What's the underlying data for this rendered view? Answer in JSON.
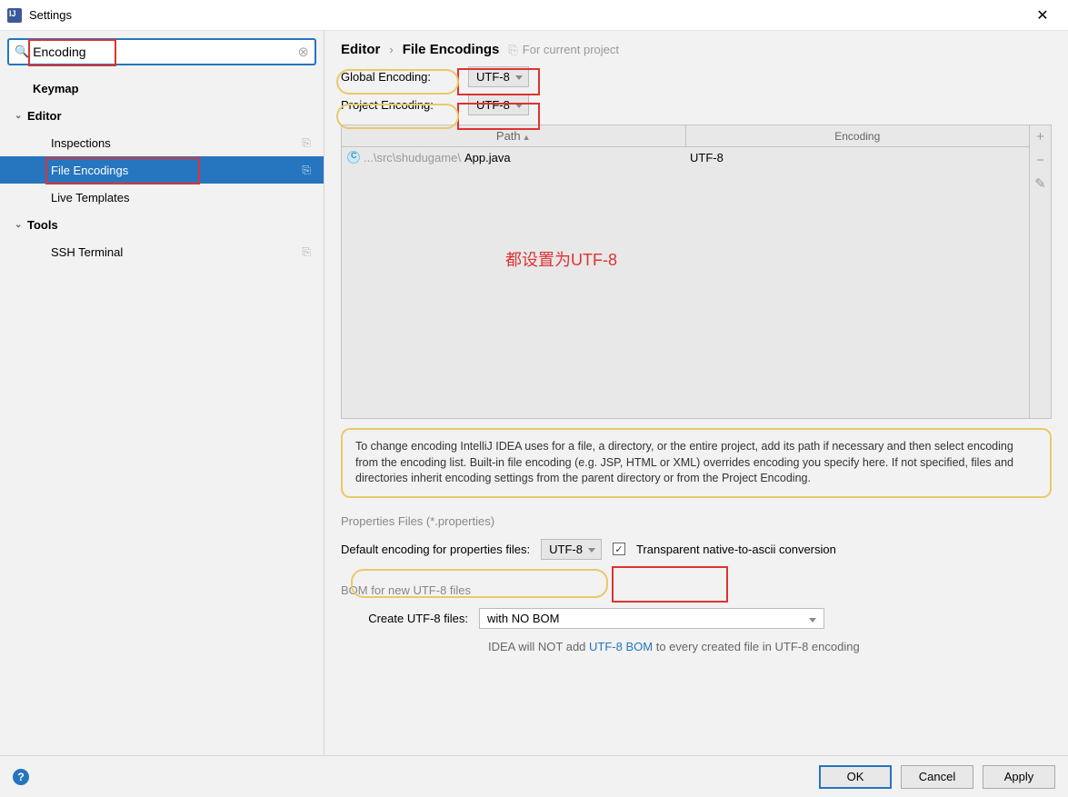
{
  "window": {
    "title": "Settings"
  },
  "search": {
    "value": "Encoding"
  },
  "tree": {
    "keymap": "Keymap",
    "editor": "Editor",
    "inspections": "Inspections",
    "file_encodings": "File Encodings",
    "live_templates": "Live Templates",
    "tools": "Tools",
    "ssh_terminal": "SSH Terminal"
  },
  "breadcrumb": {
    "a": "Editor",
    "b": "File Encodings",
    "scope": "For current project"
  },
  "encoding": {
    "global_label": "Global Encoding:",
    "global_value": "UTF-8",
    "project_label": "Project Encoding:",
    "project_value": "UTF-8"
  },
  "table": {
    "col_path": "Path",
    "col_enc": "Encoding",
    "rows": [
      {
        "prefix": "...\\src\\shudugame\\",
        "name": "App.java",
        "encoding": "UTF-8"
      }
    ]
  },
  "annotation": "都设置为UTF-8",
  "info_text": "To change encoding IntelliJ IDEA uses for a file, a directory, or the entire project, add its path if necessary and then select encoding from the encoding list. Built-in file encoding (e.g. JSP, HTML or XML) overrides encoding you specify here. If not specified, files and directories inherit encoding settings from the parent directory or from the Project Encoding.",
  "properties": {
    "section": "Properties Files (*.properties)",
    "label": "Default encoding for properties files:",
    "value": "UTF-8",
    "checkbox_label": "Transparent native-to-ascii conversion"
  },
  "bom": {
    "section": "BOM for new UTF-8 files",
    "label": "Create UTF-8 files:",
    "value": "with NO BOM",
    "note_pre": "IDEA will NOT add ",
    "note_link": "UTF-8 BOM",
    "note_post": " to every created file in UTF-8 encoding"
  },
  "buttons": {
    "ok": "OK",
    "cancel": "Cancel",
    "apply": "Apply"
  }
}
